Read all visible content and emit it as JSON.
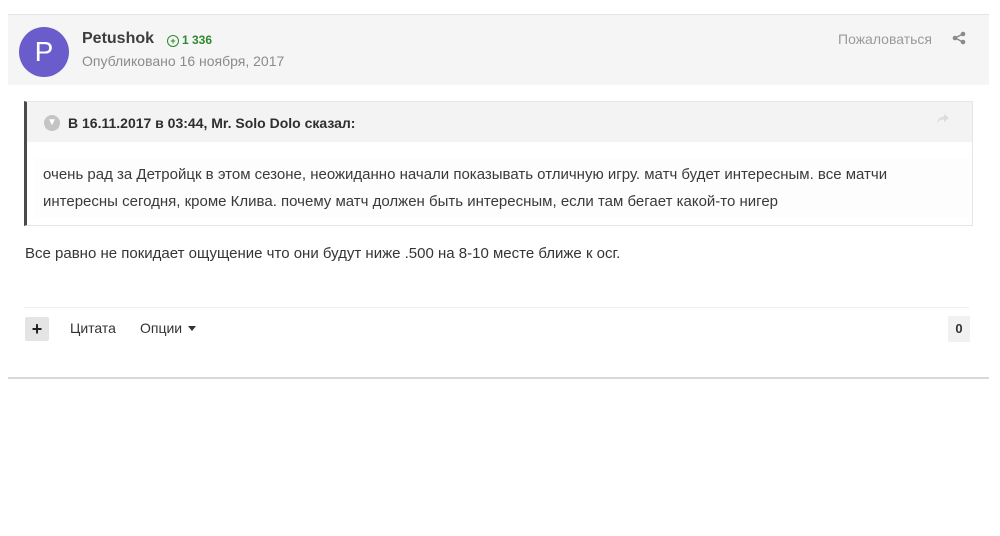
{
  "post": {
    "avatar_letter": "P",
    "avatar_color": "#6b5ccc",
    "author": "Petushok",
    "reputation": "1 336",
    "published": "Опубликовано 16 ноября, 2017",
    "report_label": "Пожаловаться",
    "share_icon": "share-icon"
  },
  "quote": {
    "toggle_icon": "chevron-down-icon",
    "citation": "В 16.11.2017 в 03:44, Mr. Solo Dolo сказал:",
    "text": "очень рад за Детройцк в этом сезоне, неожиданно начали показывать отличную игру. матч будет интересным. все матчи интересны сегодня, кроме Клива. почему матч должен быть интересным, если там бегает какой-то нигер"
  },
  "body": {
    "text": "Все равно не покидает ощущение что они будут ниже .500 на 8-10 месте ближе к осг."
  },
  "footer": {
    "plus_label": "+",
    "quote_label": "Цитата",
    "options_label": "Опции",
    "reaction_count": "0"
  }
}
